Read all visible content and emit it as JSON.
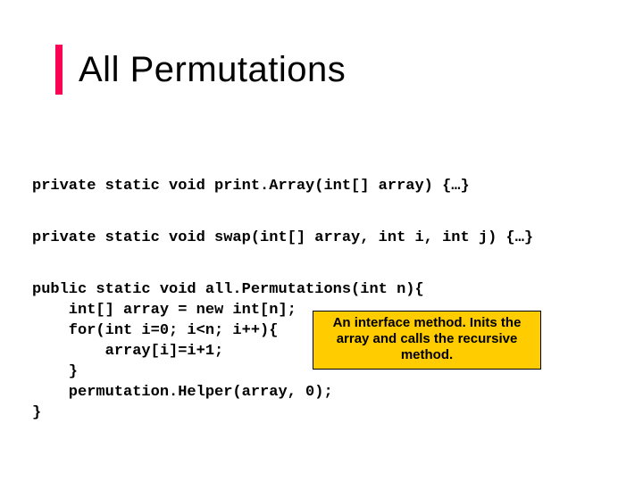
{
  "title": "All Permutations",
  "code": {
    "line1": "private static void print.Array(int[] array) {…}",
    "line2": "private static void swap(int[] array, int i, int j) {…}",
    "main": "public static void all.Permutations(int n){\n    int[] array = new int[n];\n    for(int i=0; i<n; i++){\n        array[i]=i+1;\n    }\n    permutation.Helper(array, 0);\n}"
  },
  "callout": "An interface method. Inits the array and calls the recursive method."
}
